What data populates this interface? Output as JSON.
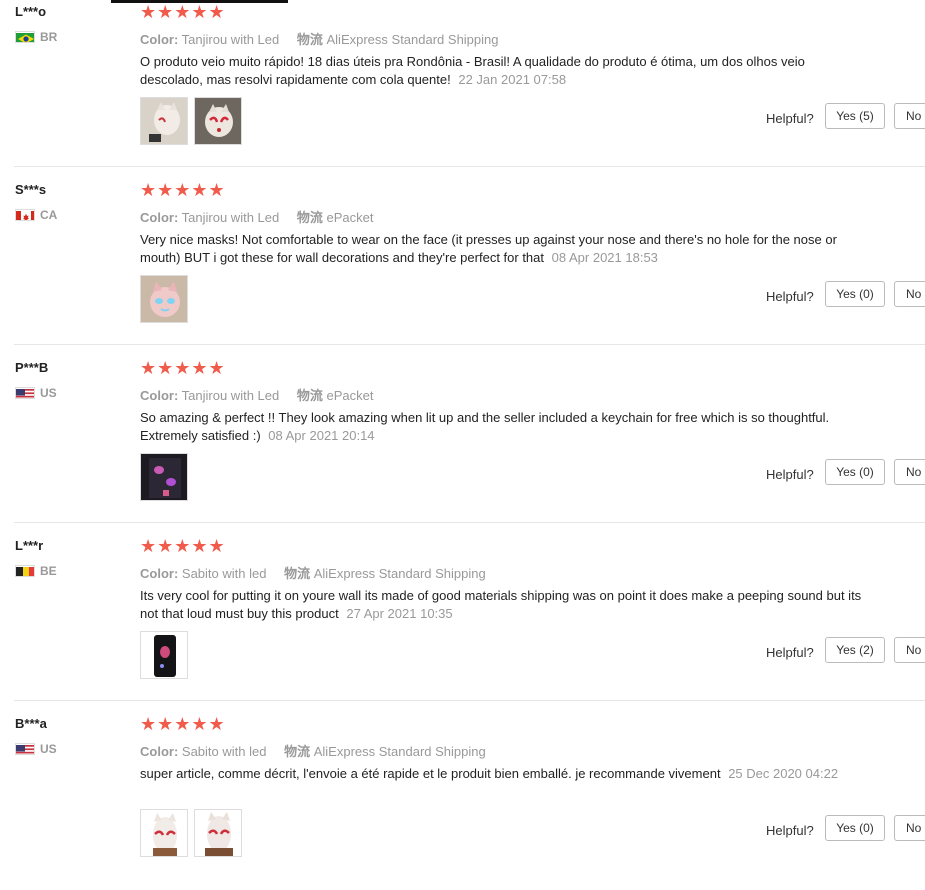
{
  "ui": {
    "helpful_label": "Helpful?",
    "color_label": "Color:",
    "shipping_label": "物流",
    "no_label": "No"
  },
  "reviews": [
    {
      "user": "L***o",
      "country_code": "BR",
      "flag": "brazil-flag-icon",
      "rating": "★★★★★",
      "color": "Tanjirou with Led",
      "shipping": "AliExpress Standard Shipping",
      "text": "O produto veio muito rápido! 18 dias úteis pra Rondônia - Brasil! A qualidade do produto é ótima, um dos olhos veio descolado, mas resolvi rapidamente com cola quente!",
      "date": "22 Jan 2021 07:58",
      "yes_label": "Yes (5)"
    },
    {
      "user": "S***s",
      "country_code": "CA",
      "flag": "canada-flag-icon",
      "rating": "★★★★★",
      "color": "Tanjirou with Led",
      "shipping": "ePacket",
      "text": "Very nice masks! Not comfortable to wear on the face (it presses up against your nose and there's no hole for the nose or mouth) BUT i got these for wall decorations and they're perfect for that",
      "date": "08 Apr 2021 18:53",
      "yes_label": "Yes (0)"
    },
    {
      "user": "P***B",
      "country_code": "US",
      "flag": "usa-flag-icon",
      "rating": "★★★★★",
      "color": "Tanjirou with Led",
      "shipping": "ePacket",
      "text": "So amazing & perfect !! They look amazing when lit up and the seller included a keychain for free which is so thoughtful. Extremely satisfied :)",
      "date": "08 Apr 2021 20:14",
      "yes_label": "Yes (0)"
    },
    {
      "user": "L***r",
      "country_code": "BE",
      "flag": "belgium-flag-icon",
      "rating": "★★★★★",
      "color": "Sabito with led",
      "shipping": "AliExpress Standard Shipping",
      "text": "Its very cool for putting it on youre wall its made of good materials shipping was on point it does make a peeping sound but its not that loud must buy this product",
      "date": "27 Apr 2021 10:35",
      "yes_label": "Yes (2)"
    },
    {
      "user": "B***a",
      "country_code": "US",
      "flag": "usa-flag-icon",
      "rating": "★★★★★",
      "color": "Sabito with led",
      "shipping": "AliExpress Standard Shipping",
      "text": "super article, comme décrit, l'envoie a été rapide et le produit bien emballé. je recommande vivement",
      "date": "25 Dec 2020 04:22",
      "yes_label": "Yes (0)"
    }
  ]
}
